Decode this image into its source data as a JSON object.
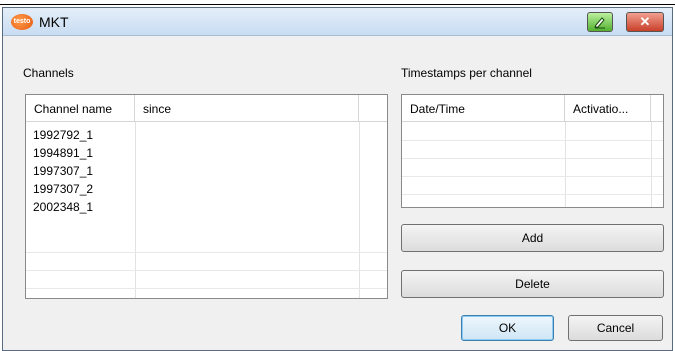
{
  "window": {
    "title": "MKT",
    "app_icon_text": "testo"
  },
  "channels": {
    "label": "Channels",
    "columns": [
      "Channel name",
      "since"
    ],
    "rows": [
      {
        "name": "1992792_1",
        "since": ""
      },
      {
        "name": "1994891_1",
        "since": ""
      },
      {
        "name": "1997307_1",
        "since": ""
      },
      {
        "name": "1997307_2",
        "since": ""
      },
      {
        "name": "2002348_1",
        "since": ""
      }
    ]
  },
  "timestamps": {
    "label": "Timestamps per channel",
    "columns": [
      "Date/Time",
      "Activatio..."
    ]
  },
  "buttons": {
    "add": "Add",
    "delete": "Delete",
    "ok": "OK",
    "cancel": "Cancel",
    "close_glyph": "✕"
  },
  "colors": {
    "titlebar": "#c9dcf2",
    "close_button": "#c8402a",
    "edit_button": "#52b030"
  }
}
